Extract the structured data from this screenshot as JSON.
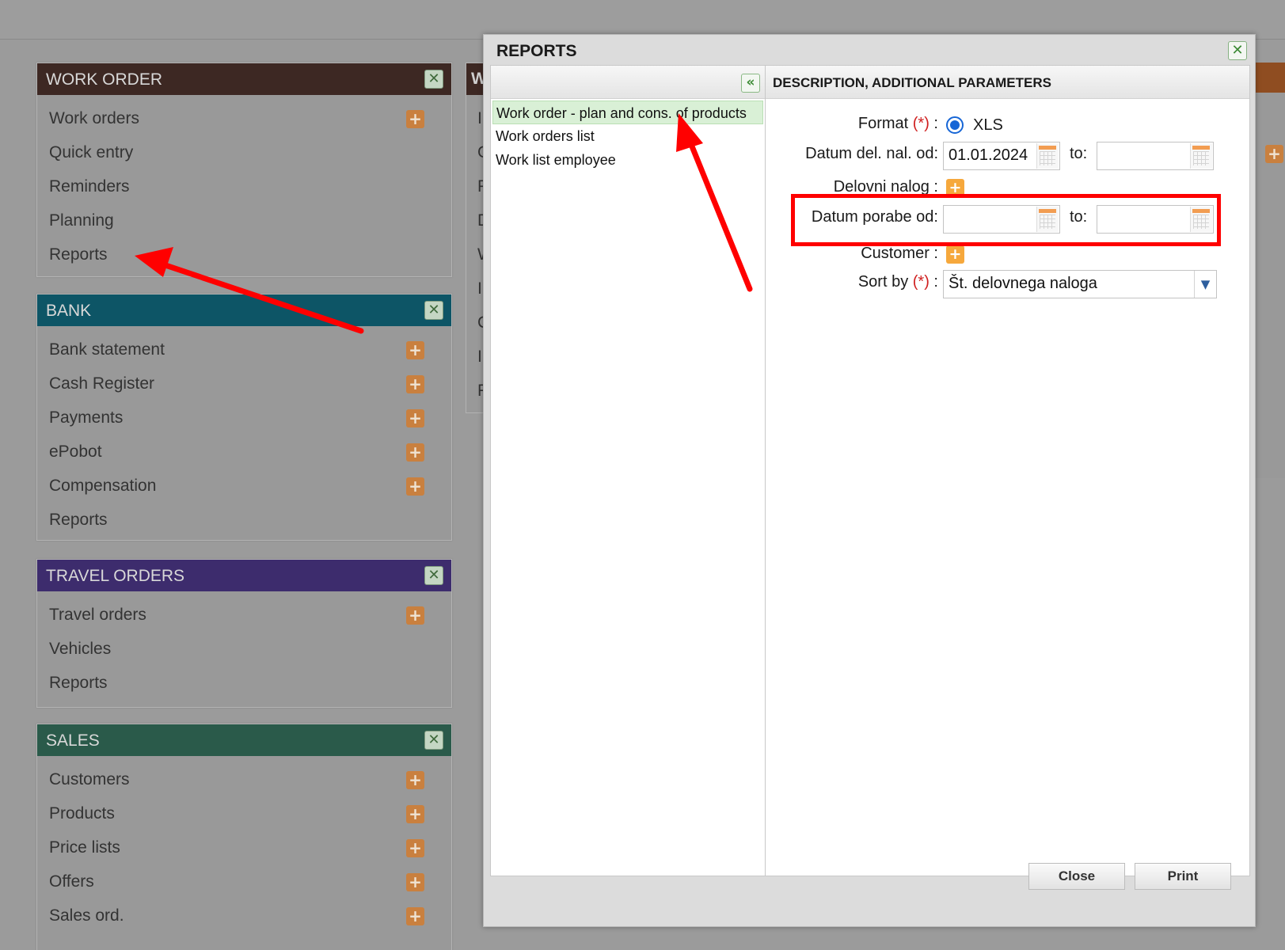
{
  "panels": {
    "work_order": {
      "title": "WORK ORDER",
      "color": "#3d2823",
      "items": [
        {
          "label": "Work orders",
          "plus": true
        },
        {
          "label": "Quick entry",
          "plus": false
        },
        {
          "label": "Reminders",
          "plus": false
        },
        {
          "label": "Planning",
          "plus": false
        },
        {
          "label": "Reports",
          "plus": false
        }
      ]
    },
    "bank": {
      "title": "BANK",
      "color": "#0d5566",
      "items": [
        {
          "label": "Bank statement",
          "plus": true
        },
        {
          "label": "Cash Register",
          "plus": true
        },
        {
          "label": "Payments",
          "plus": true
        },
        {
          "label": "ePobot",
          "plus": true
        },
        {
          "label": "Compensation",
          "plus": true
        },
        {
          "label": "Reports",
          "plus": false
        }
      ]
    },
    "travel_orders": {
      "title": "TRAVEL ORDERS",
      "color": "#3d2c6d",
      "items": [
        {
          "label": "Travel orders",
          "plus": true
        },
        {
          "label": "Vehicles",
          "plus": false
        },
        {
          "label": "Reports",
          "plus": false
        }
      ]
    },
    "sales": {
      "title": "SALES",
      "color": "#2a5a4a",
      "items": [
        {
          "label": "Customers",
          "plus": true
        },
        {
          "label": "Products",
          "plus": true
        },
        {
          "label": "Price lists",
          "plus": true
        },
        {
          "label": "Offers",
          "plus": true
        },
        {
          "label": "Sales ord.",
          "plus": true
        }
      ]
    }
  },
  "second_panel": {
    "title": "W",
    "items": [
      "I",
      "G",
      "P",
      "D",
      "W",
      "I",
      "C",
      "I",
      "R"
    ]
  },
  "modal": {
    "title": "REPORTS",
    "reports": [
      "Work order - plan and cons. of products",
      "Work orders list",
      "Work list employee"
    ],
    "selected_index": 0,
    "params_header": "DESCRIPTION, ADDITIONAL PARAMETERS",
    "fields": {
      "format_label": "Format",
      "format_value": "XLS",
      "datum_del_label": "Datum del. nal. od:",
      "datum_del_from": "01.01.2024",
      "datum_del_to": "",
      "to_label": "to:",
      "delovni_label": "Delovni nalog :",
      "datum_porabe_label": "Datum porabe od:",
      "datum_porabe_from": "",
      "datum_porabe_to": "",
      "customer_label": "Customer :",
      "sortby_label": "Sort by",
      "sortby_value": "Št. delovnega naloga",
      "required_mark": "(*)",
      "colon": " :"
    },
    "buttons": {
      "close": "Close",
      "print": "Print"
    }
  },
  "colors": {
    "highlight": "#ff0000",
    "arrow": "#ff0000"
  }
}
